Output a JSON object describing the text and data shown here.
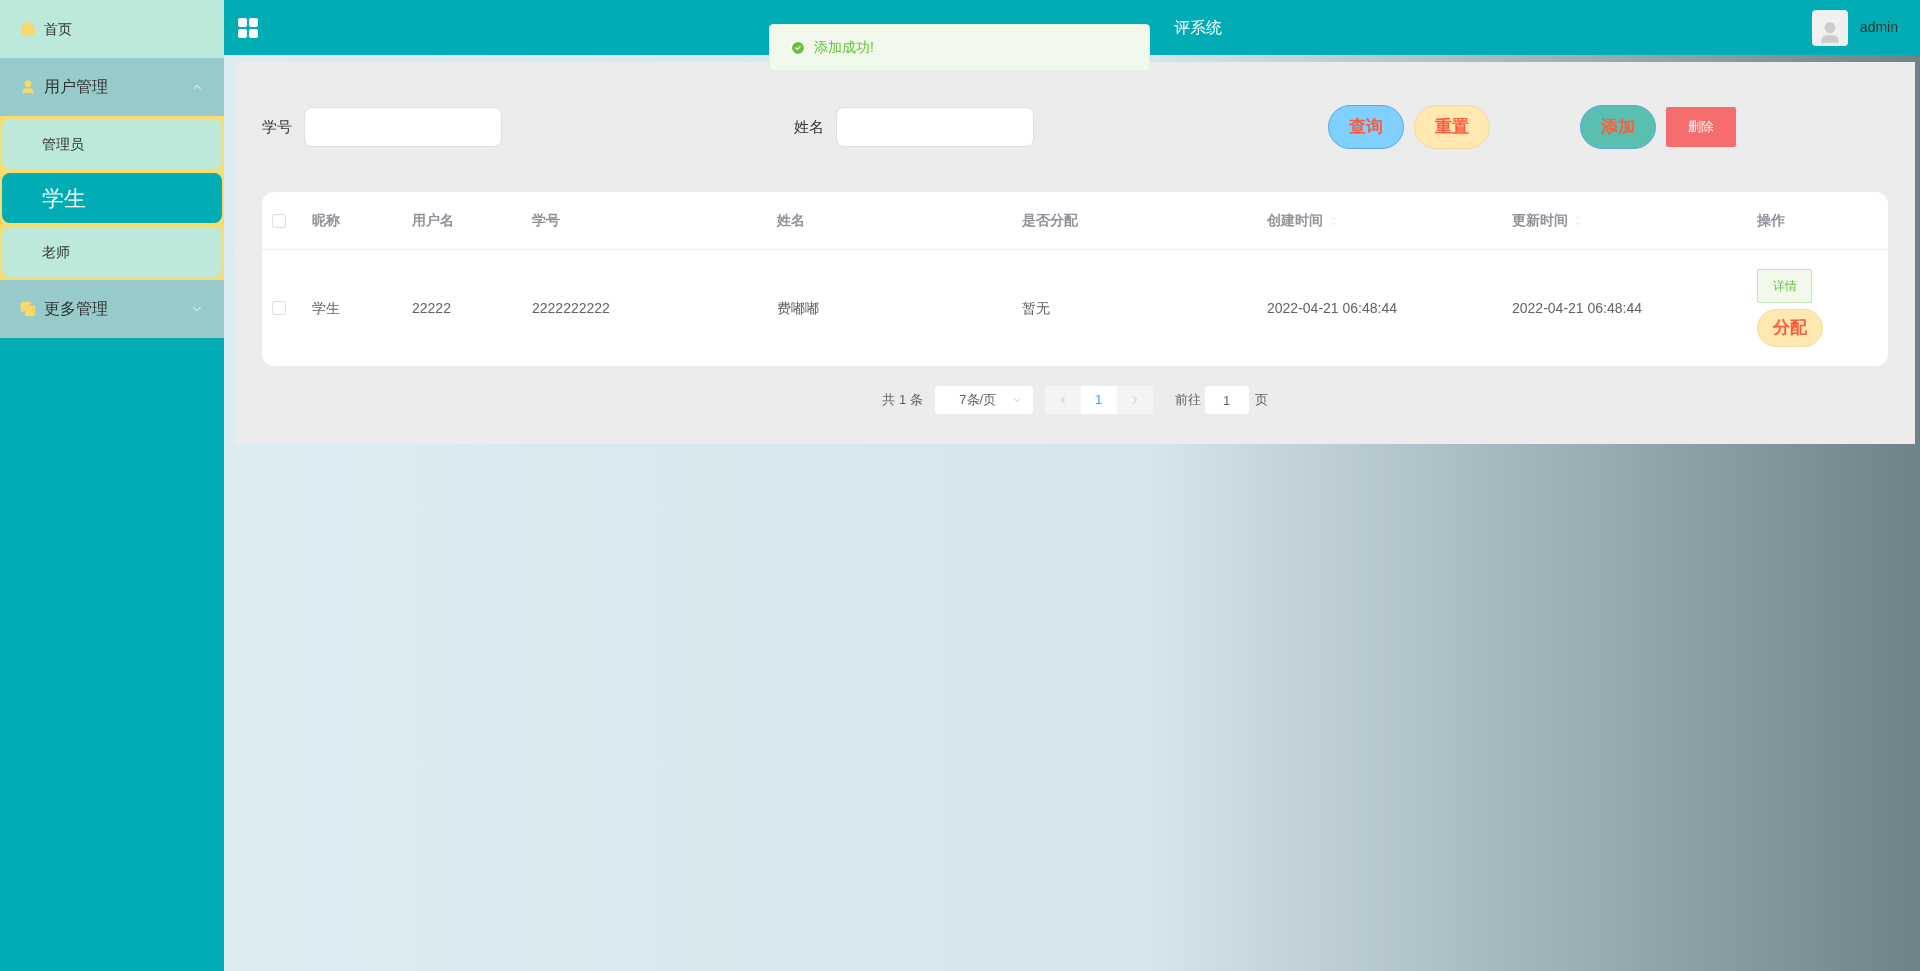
{
  "sidebar": {
    "items": [
      {
        "label": "首页",
        "kind": "link",
        "selected": false
      },
      {
        "label": "用户管理",
        "kind": "group",
        "expanded": true,
        "children": [
          {
            "label": "管理员",
            "selected": false
          },
          {
            "label": "学生",
            "selected": true
          },
          {
            "label": "老师",
            "selected": false
          }
        ]
      },
      {
        "label": "更多管理",
        "kind": "group",
        "expanded": false
      }
    ]
  },
  "header": {
    "title": "评系统",
    "user": "admin"
  },
  "toast": {
    "message": "添加成功!"
  },
  "search": {
    "fields": [
      {
        "label": "学号"
      },
      {
        "label": "姓名"
      }
    ],
    "buttons": [
      {
        "label": "查询",
        "kind": "query"
      },
      {
        "label": "重置",
        "kind": "reset"
      },
      {
        "label": "添加",
        "kind": "add"
      },
      {
        "label": "删除",
        "kind": "delete"
      }
    ]
  },
  "table": {
    "all_checked": false,
    "columns": [
      {
        "label": "昵称",
        "kind": "plain"
      },
      {
        "label": "用户名",
        "kind": "plain"
      },
      {
        "label": "学号",
        "kind": "plain"
      },
      {
        "label": "姓名",
        "kind": "plain"
      },
      {
        "label": "是否分配",
        "kind": "plain"
      },
      {
        "label": "创建时间",
        "kind": "sortable"
      },
      {
        "label": "更新时间",
        "kind": "sortable"
      },
      {
        "label": "操作",
        "kind": "plain"
      }
    ],
    "rows": [
      {
        "checked": false,
        "cells": [
          "学生",
          "22222",
          "2222222222",
          "费嘟嘟",
          "暂无",
          "2022-04-21 06:48:44",
          "2022-04-21 06:48:44"
        ],
        "actions": [
          {
            "label": "详情",
            "kind": "detail"
          },
          {
            "label": "分配",
            "kind": "assign"
          }
        ]
      }
    ]
  },
  "pagination": {
    "total": "共 1 条",
    "page_size": "7条/页",
    "pages": [
      {
        "label": "1",
        "selected": true
      }
    ],
    "goto_label": "前往",
    "goto_value": "1",
    "goto_suffix": "页"
  }
}
